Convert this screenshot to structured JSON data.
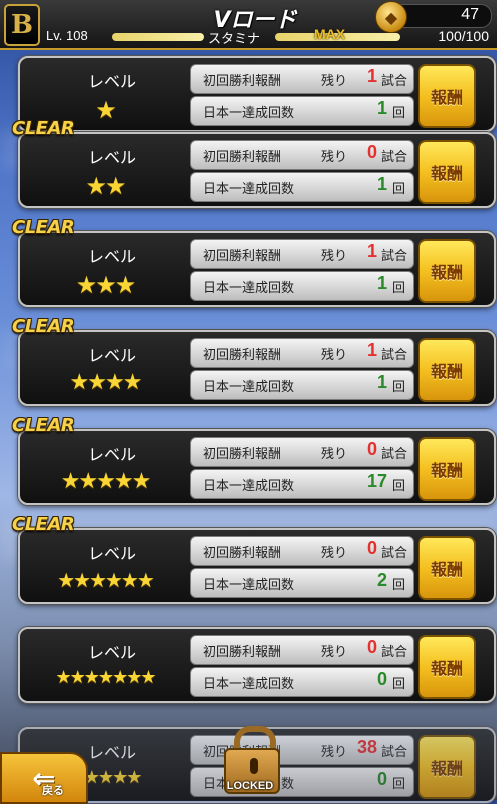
{
  "header": {
    "logo": "B",
    "title": "Vロード",
    "coin_icon": "gold-coin-icon",
    "coins": "47",
    "level": "Lv. 108",
    "level_progress": 1.0,
    "stamina_label": "スタミナ",
    "stamina_max_label": "MAX",
    "stamina_value": "100/100",
    "stamina_progress": 1.0
  },
  "labels": {
    "level": "レベル",
    "first_win_reward": "初回勝利報酬",
    "remaining": "残り",
    "games_unit": "試合",
    "japan_champ_count": "日本一達成回数",
    "times_unit": "回",
    "reward_button": "報酬",
    "clear": "CLEAR",
    "locked": "LOCKED",
    "back": "戻る"
  },
  "levels": [
    {
      "stars": 1,
      "clear": false,
      "remaining": "1",
      "achievements": "1"
    },
    {
      "stars": 2,
      "clear": true,
      "remaining": "0",
      "achievements": "1"
    },
    {
      "stars": 3,
      "clear": true,
      "remaining": "1",
      "achievements": "1"
    },
    {
      "stars": 4,
      "clear": true,
      "remaining": "1",
      "achievements": "1"
    },
    {
      "stars": 5,
      "clear": true,
      "remaining": "0",
      "achievements": "17"
    },
    {
      "stars": 6,
      "clear": true,
      "remaining": "0",
      "achievements": "2"
    },
    {
      "stars": 7,
      "clear": false,
      "remaining": "0",
      "achievements": "0"
    },
    {
      "stars": 5,
      "clear": false,
      "locked": true,
      "remaining": "38",
      "achievements": "0"
    }
  ]
}
